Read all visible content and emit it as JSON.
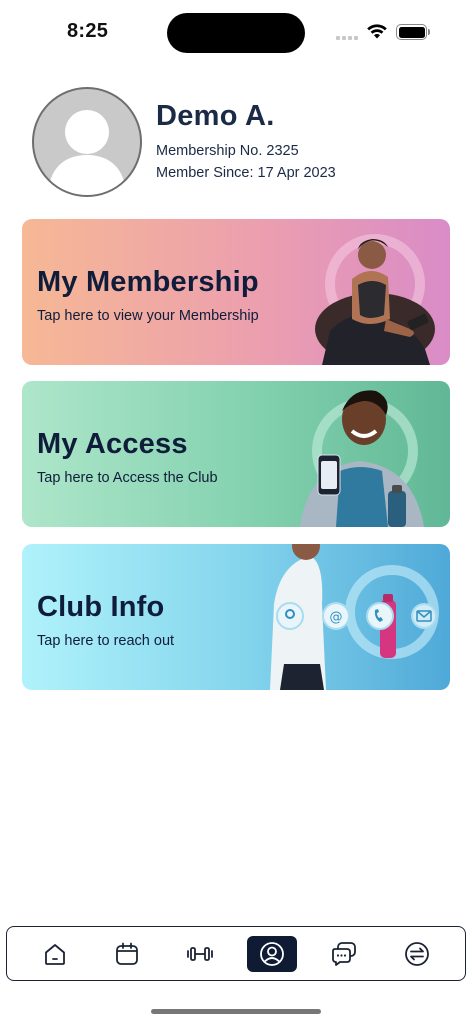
{
  "status_bar": {
    "time": "8:25",
    "icons": [
      "cellular-signal-icon",
      "wifi-icon",
      "battery-icon"
    ]
  },
  "profile": {
    "name": "Demo A.",
    "membership_number": "Membership No. 2325",
    "member_since": "Member Since: 17 Apr 2023",
    "avatar_icon": "user-placeholder-icon"
  },
  "cards": [
    {
      "title": "My Membership",
      "subtitle": "Tap here to view your Membership",
      "image": "woman-with-phone"
    },
    {
      "title": "My Access",
      "subtitle": "Tap here to Access the Club",
      "image": "man-with-phone-and-bottle"
    },
    {
      "title": "Club Info",
      "subtitle": "Tap here to reach out",
      "image": "contact-icons-location-email-phone-mail"
    }
  ],
  "bottom_nav": {
    "items": [
      "home-icon",
      "calendar-icon",
      "dumbbell-icon",
      "profile-icon",
      "chat-icon",
      "switch-icon"
    ],
    "active": "profile-icon"
  },
  "colors": {
    "text_primary": "#1b2a45",
    "nav_active_bg": "#0e1b33",
    "membership_gradient": [
      "#f6b895",
      "#d98cc7"
    ],
    "access_gradient": [
      "#aee6ca",
      "#61b896"
    ],
    "club_gradient": [
      "#b0f2fb",
      "#4fa9d8"
    ]
  }
}
